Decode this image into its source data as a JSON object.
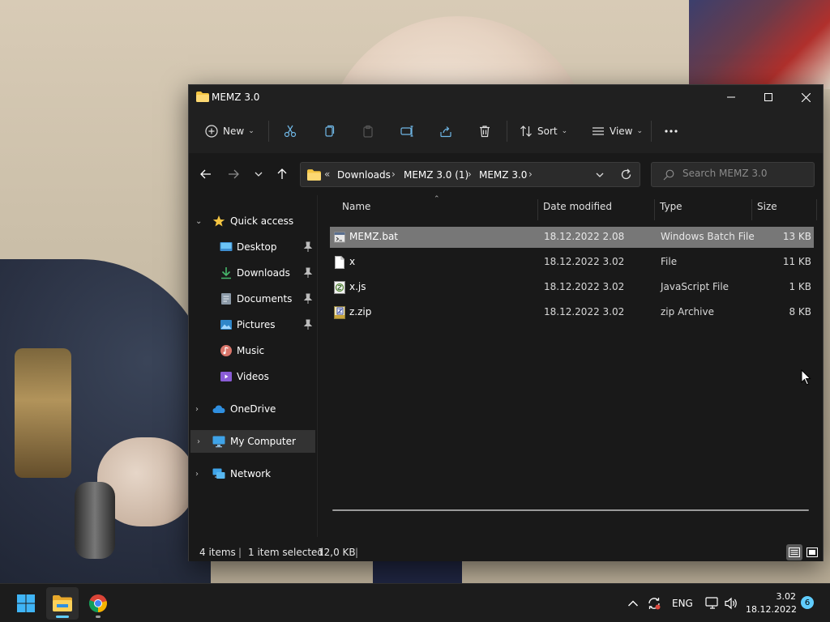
{
  "window": {
    "title": "MEMZ 3.0"
  },
  "toolbar": {
    "new_label": "New",
    "sort_label": "Sort",
    "view_label": "View"
  },
  "address": {
    "overflow": "«",
    "crumbs": [
      "Downloads",
      "MEMZ 3.0 (1)",
      "MEMZ 3.0"
    ]
  },
  "search": {
    "placeholder": "Search MEMZ 3.0"
  },
  "navpane": {
    "quick_access": "Quick access",
    "items": [
      "Desktop",
      "Downloads",
      "Documents",
      "Pictures",
      "Music",
      "Videos"
    ],
    "onedrive": "OneDrive",
    "my_computer": "My Computer",
    "network": "Network"
  },
  "columns": {
    "name": "Name",
    "date": "Date modified",
    "type": "Type",
    "size": "Size"
  },
  "files": [
    {
      "name": "MEMZ.bat",
      "date": "18.12.2022 2.08",
      "type": "Windows Batch File",
      "size": "13 KB",
      "icon": "batch-file-icon",
      "selected": true
    },
    {
      "name": "x",
      "date": "18.12.2022 3.02",
      "type": "File",
      "size": "11 KB",
      "icon": "blank-file-icon",
      "selected": false
    },
    {
      "name": "x.js",
      "date": "18.12.2022 3.02",
      "type": "JavaScript File",
      "size": "1 KB",
      "icon": "javascript-file-icon",
      "selected": false
    },
    {
      "name": "z.zip",
      "date": "18.12.2022 3.02",
      "type": "zip Archive",
      "size": "8 KB",
      "icon": "zip-archive-icon",
      "selected": false
    }
  ],
  "status": {
    "item_count": "4 items",
    "selection": "1 item selected",
    "selection_size": "12,0 KB"
  },
  "taskbar": {
    "language": "ENG",
    "time": "3.02",
    "date": "18.12.2022",
    "notifications": "6"
  },
  "colors": {
    "accent": "#60cdff",
    "selection": "#777777",
    "folder": "#f4c542"
  }
}
